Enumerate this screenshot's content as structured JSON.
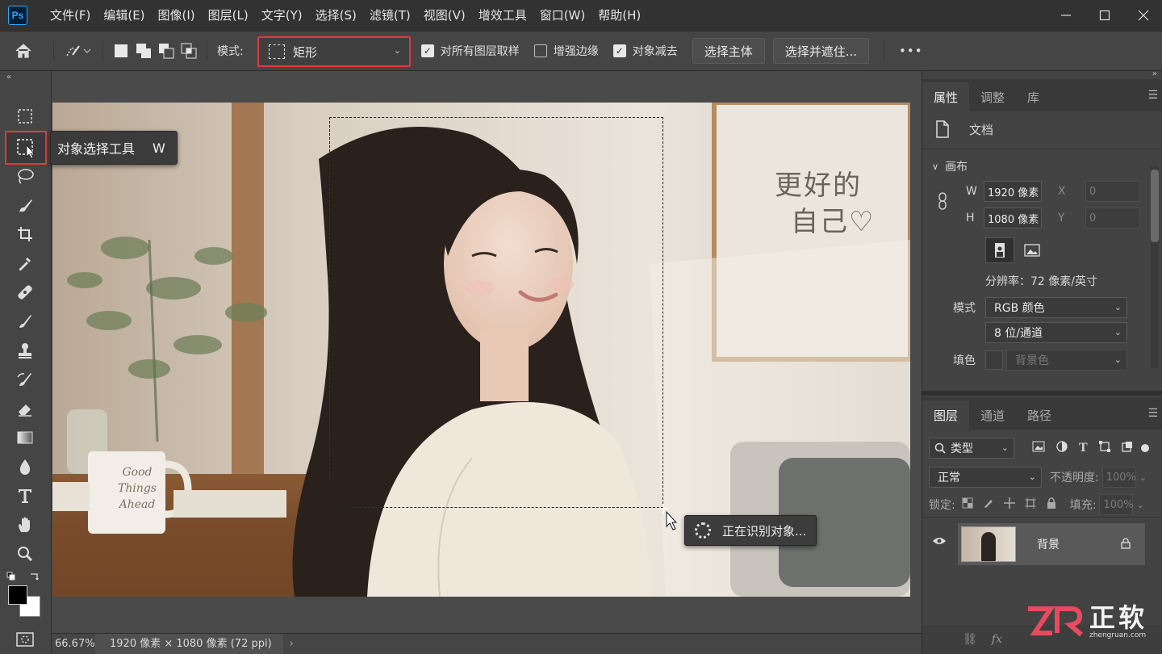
{
  "app": {
    "logo": "Ps"
  },
  "menu": [
    "文件(F)",
    "编辑(E)",
    "图像(I)",
    "图层(L)",
    "文字(Y)",
    "选择(S)",
    "滤镜(T)",
    "视图(V)",
    "增效工具",
    "窗口(W)",
    "帮助(H)"
  ],
  "options": {
    "mode_label": "模式:",
    "mode_value": "矩形",
    "sample_all_layers": {
      "label": "对所有图层取样",
      "checked": true
    },
    "enhance_edge": {
      "label": "增强边缘",
      "checked": false
    },
    "object_subtract": {
      "label": "对象减去",
      "checked": true
    },
    "select_subject": "选择主体",
    "select_and_mask": "选择并遮住...",
    "more": "•••"
  },
  "tooltip": {
    "name": "对象选择工具",
    "key": "W"
  },
  "canvas": {
    "status_text": "正在识别对象...",
    "mug_text": "Good\nThings\nAhead",
    "wall_text_line1": "更好的",
    "wall_text_line2": "自己♡"
  },
  "statusbar": {
    "zoom": "66.67%",
    "doc_info": "1920 像素 × 1080 像素 (72 ppi)"
  },
  "properties": {
    "tabs": [
      "属性",
      "调整",
      "库"
    ],
    "doc_label": "文档",
    "section_canvas": "画布",
    "w_label": "W",
    "w_value": "1920 像素",
    "h_label": "H",
    "h_value": "1080 像素",
    "x_label": "X",
    "x_value": "0",
    "y_label": "Y",
    "y_value": "0",
    "resolution": "分辨率：72 像素/英寸",
    "mode_label": "模式",
    "mode_value": "RGB 颜色",
    "depth_value": "8 位/通道",
    "fill_label": "填色",
    "fill_value": "背景色"
  },
  "layers": {
    "tabs": [
      "图层",
      "通道",
      "路径"
    ],
    "filter_label": "类型",
    "blend_mode": "正常",
    "opacity_label": "不透明度:",
    "opacity_value": "100%",
    "lock_label": "锁定:",
    "fill_label": "填充:",
    "fill_value": "100%",
    "layer_name": "背景"
  },
  "watermark": {
    "brand": "正软",
    "url": "zhengruan.com"
  },
  "colors": {
    "highlight_red": "#e23a3a",
    "ps_blue": "#31a8ff",
    "panel_bg": "#434343"
  }
}
